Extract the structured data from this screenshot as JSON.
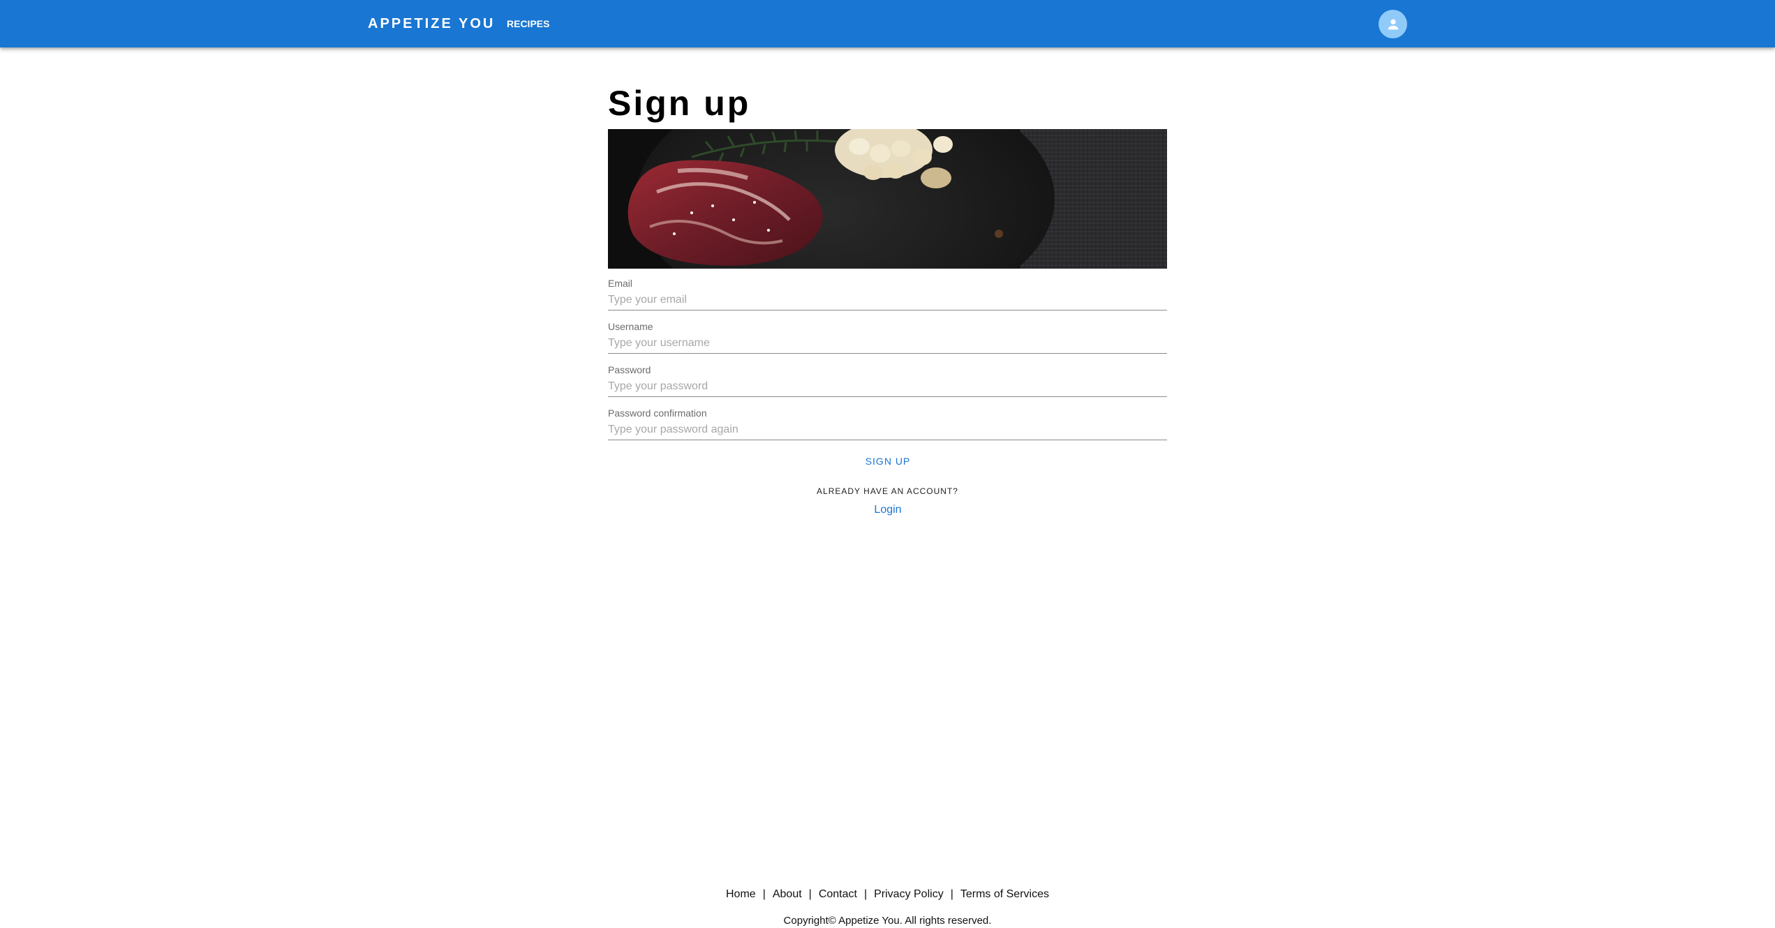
{
  "header": {
    "brand": "APPETIZE YOU",
    "nav_recipes": "RECIPES",
    "account_icon": "account-circle-icon"
  },
  "main": {
    "title": "Sign up",
    "hero_image": "raw steak with rosemary and garlic on a dark plate"
  },
  "form": {
    "email": {
      "label": "Email",
      "placeholder": "Type your email",
      "value": ""
    },
    "username": {
      "label": "Username",
      "placeholder": "Type your username",
      "value": ""
    },
    "password": {
      "label": "Password",
      "placeholder": "Type your password",
      "value": ""
    },
    "password_confirmation": {
      "label": "Password confirmation",
      "placeholder": "Type your password again",
      "value": ""
    },
    "submit_label": "SIGN UP"
  },
  "login_prompt": {
    "text": "ALREADY HAVE AN ACCOUNT?",
    "link": "Login"
  },
  "footer": {
    "links": [
      "Home",
      "About",
      "Contact",
      "Privacy Policy",
      "Terms of Services"
    ],
    "separator": "|",
    "copyright": "Copyright© Appetize You. All rights reserved."
  },
  "colors": {
    "primary": "#1976d2",
    "avatar_bg": "#90caf9"
  }
}
